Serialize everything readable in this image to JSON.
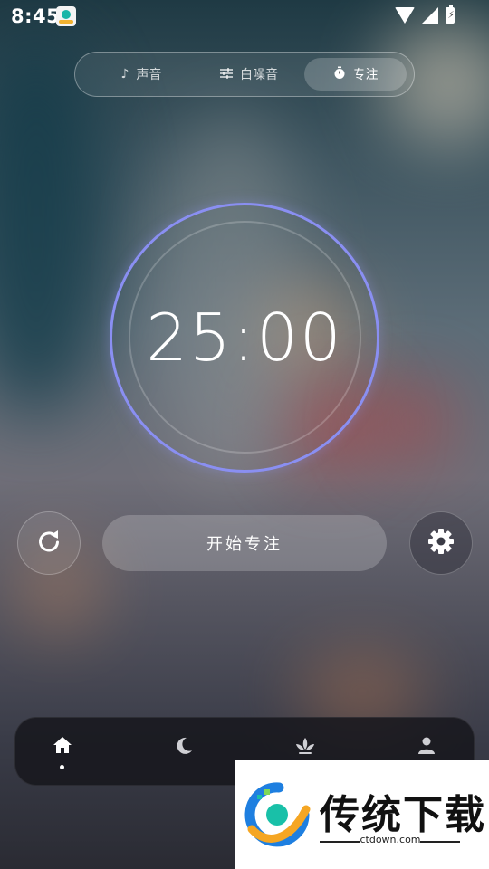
{
  "status_bar": {
    "time": "8:45"
  },
  "tabs": [
    {
      "label": "声音",
      "icon": "music-note-icon",
      "active": false
    },
    {
      "label": "白噪音",
      "icon": "sliders-icon",
      "active": false
    },
    {
      "label": "专注",
      "icon": "stopwatch-icon",
      "active": true
    }
  ],
  "timer": {
    "display": "25:00"
  },
  "controls": {
    "start_label": "开始专注",
    "reset_icon": "refresh-icon",
    "settings_icon": "gear-icon"
  },
  "bottom_nav": [
    {
      "icon": "home-icon",
      "active": true
    },
    {
      "icon": "moon-icon",
      "active": false
    },
    {
      "icon": "lotus-icon",
      "active": false
    },
    {
      "icon": "person-icon",
      "active": false
    }
  ],
  "watermark": {
    "title": "传统下载",
    "url": "ctdown.com"
  },
  "colors": {
    "ring": "#8a8ff2",
    "accent_blue": "#1e7fe0",
    "accent_orange": "#f5a623"
  }
}
